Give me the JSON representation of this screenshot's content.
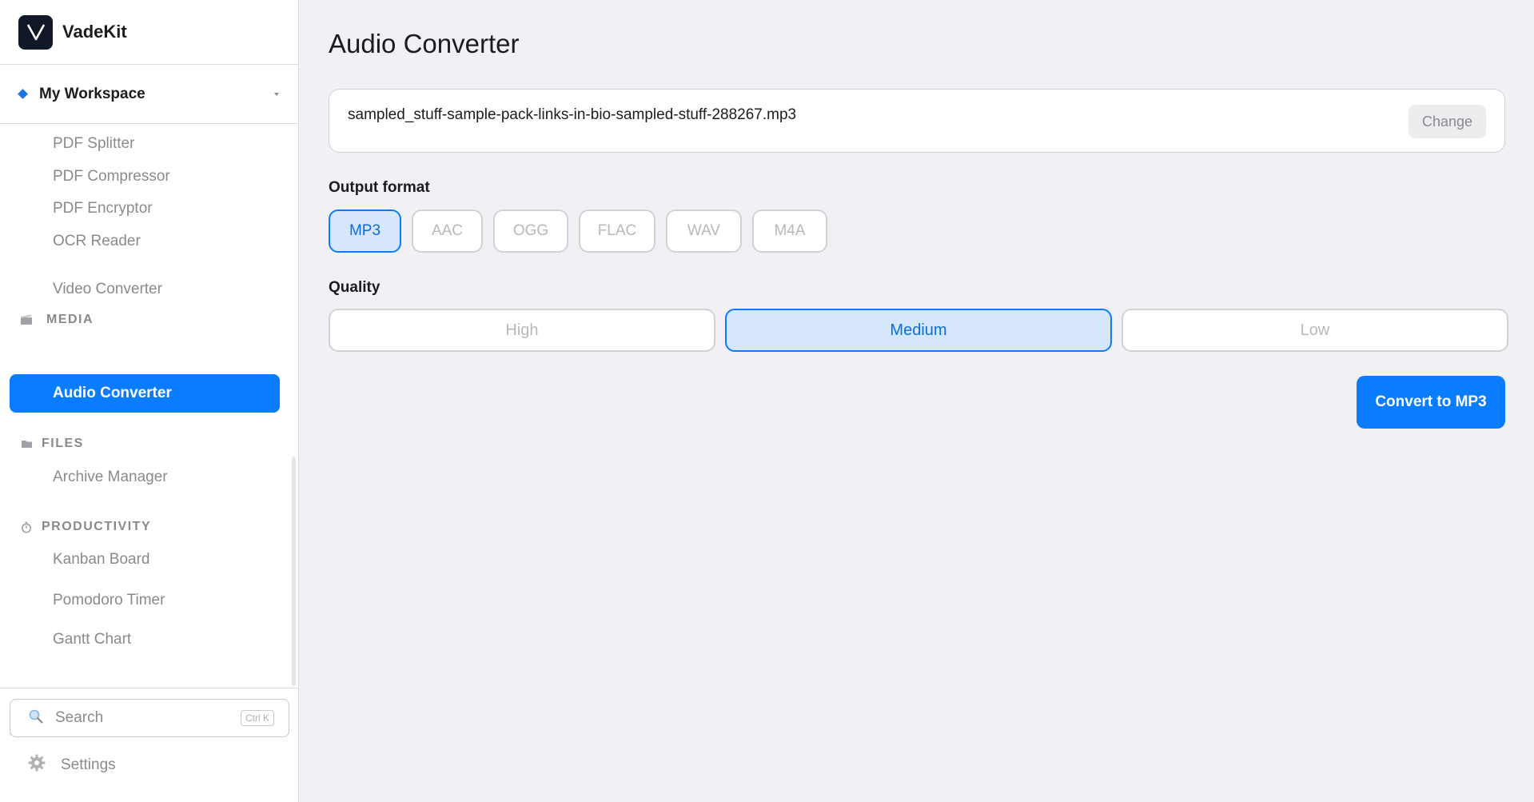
{
  "app": {
    "name": "VadeKit"
  },
  "workspace": {
    "name": "My Workspace"
  },
  "nav": {
    "pdf_items": [
      "PDF Splitter",
      "PDF Compressor",
      "PDF Encryptor",
      "OCR Reader"
    ],
    "media_label": "MEDIA",
    "media_items": [
      "Video Converter",
      "Audio Converter"
    ],
    "files_label": "FILES",
    "files_items": [
      "Archive Manager"
    ],
    "productivity_label": "PRODUCTIVITY",
    "productivity_items": [
      "Kanban Board",
      "Pomodoro Timer",
      "Gantt Chart"
    ],
    "active_item": "Audio Converter"
  },
  "footer": {
    "search_placeholder": "Search",
    "search_shortcut": "Ctrl K",
    "settings_label": "Settings"
  },
  "main": {
    "title": "Audio Converter",
    "file_name": "sampled_stuff-sample-pack-links-in-bio-sampled-stuff-288267.mp3",
    "change_label": "Change",
    "output_format_label": "Output format",
    "formats": [
      "MP3",
      "AAC",
      "OGG",
      "FLAC",
      "WAV",
      "M4A"
    ],
    "selected_format": "MP3",
    "quality_label": "Quality",
    "qualities": [
      "High",
      "Medium",
      "Low"
    ],
    "selected_quality": "Medium",
    "convert_label": "Convert to MP3"
  },
  "colors": {
    "accent": "#0a7cff",
    "selected_bg": "#d6e7fb",
    "sidebar_bg": "#ffffff",
    "main_bg": "#f0f0f5"
  }
}
